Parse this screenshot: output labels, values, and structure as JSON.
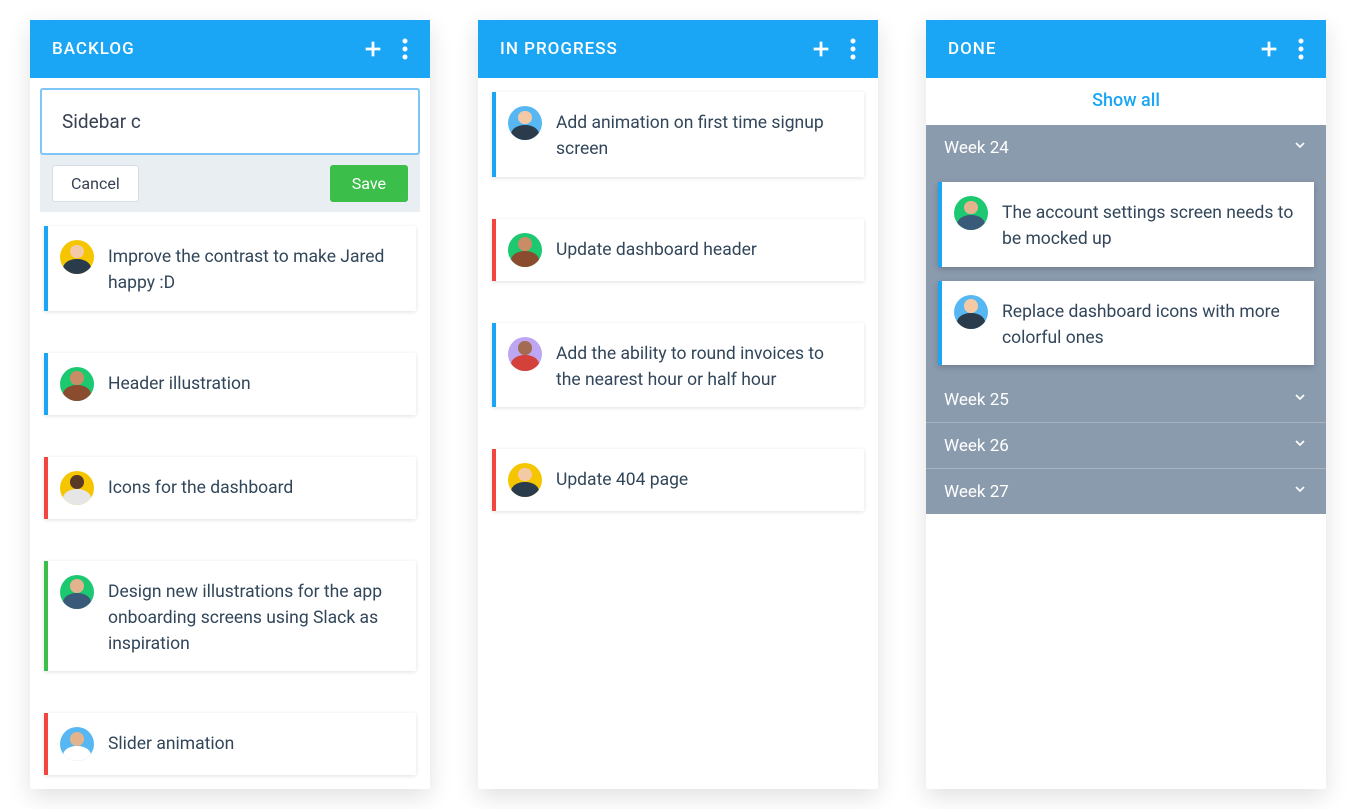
{
  "columns": {
    "backlog": {
      "title": "BACKLOG",
      "newCard": {
        "value": "Sidebar c",
        "cancel": "Cancel",
        "save": "Save"
      },
      "cards": [
        {
          "text": "Improve the contrast to make Jared happy :D",
          "stripe": "blue",
          "avatar": {
            "bg": "#f5c600",
            "skin": "#f4c9a6",
            "shirt": "#2a3b4c"
          }
        },
        {
          "text": "Header illustration",
          "stripe": "blue",
          "avatar": {
            "bg": "#1cc971",
            "skin": "#c98d66",
            "shirt": "#8a4b2e"
          }
        },
        {
          "text": "Icons for the dashboard",
          "stripe": "red",
          "avatar": {
            "bg": "#f5c600",
            "skin": "#5a3a25",
            "shirt": "#e6e6e6"
          }
        },
        {
          "text": "Design new illustrations for the app onboarding screens using Slack as inspiration",
          "stripe": "green",
          "avatar": {
            "bg": "#1cc971",
            "skin": "#e3b38d",
            "shirt": "#3a5a7a"
          }
        },
        {
          "text": "Slider animation",
          "stripe": "red",
          "avatar": {
            "bg": "#57b7f2",
            "skin": "#e3b38d",
            "shirt": "#ffffff"
          }
        }
      ]
    },
    "inprogress": {
      "title": "IN PROGRESS",
      "cards": [
        {
          "text": "Add animation on first time signup screen",
          "stripe": "blue",
          "avatar": {
            "bg": "#57b7f2",
            "skin": "#f4c9a6",
            "shirt": "#2a3b4c"
          }
        },
        {
          "text": "Update dashboard header",
          "stripe": "red",
          "avatar": {
            "bg": "#1cc971",
            "skin": "#c98d66",
            "shirt": "#8a4b2e"
          }
        },
        {
          "text": "Add the ability to round invoices to the nearest hour or half hour",
          "stripe": "blue",
          "avatar": {
            "bg": "#bda6f2",
            "skin": "#a36b4f",
            "shirt": "#d4403a"
          }
        },
        {
          "text": "Update 404 page",
          "stripe": "red",
          "avatar": {
            "bg": "#f5c600",
            "skin": "#f4c9a6",
            "shirt": "#2a3b4c"
          }
        }
      ]
    },
    "done": {
      "title": "DONE",
      "showAll": "Show all",
      "weeks": [
        {
          "label": "Week 24",
          "expanded": true,
          "cards": [
            {
              "text": "The account settings screen needs to be mocked up",
              "stripe": "blue",
              "avatar": {
                "bg": "#1cc971",
                "skin": "#e3b38d",
                "shirt": "#3a5a7a"
              }
            },
            {
              "text": "Replace dashboard icons with more colorful ones",
              "stripe": "blue",
              "avatar": {
                "bg": "#57b7f2",
                "skin": "#f4c9a6",
                "shirt": "#2a3b4c"
              }
            }
          ]
        },
        {
          "label": "Week 25",
          "expanded": false
        },
        {
          "label": "Week 26",
          "expanded": false
        },
        {
          "label": "Week 27",
          "expanded": false
        }
      ]
    }
  }
}
